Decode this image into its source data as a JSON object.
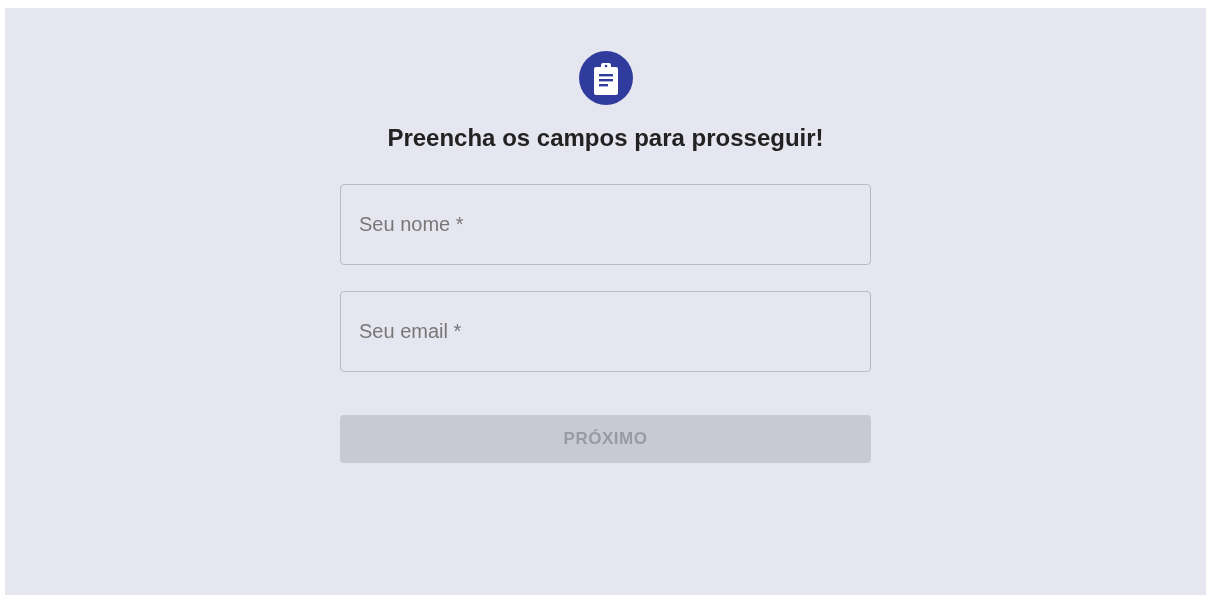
{
  "form": {
    "title": "Preencha os campos para prosseguir!",
    "fields": [
      {
        "placeholder": "Seu nome *"
      },
      {
        "placeholder": "Seu email *"
      }
    ],
    "button": {
      "label": "PRÓXIMO",
      "disabled": true
    }
  }
}
